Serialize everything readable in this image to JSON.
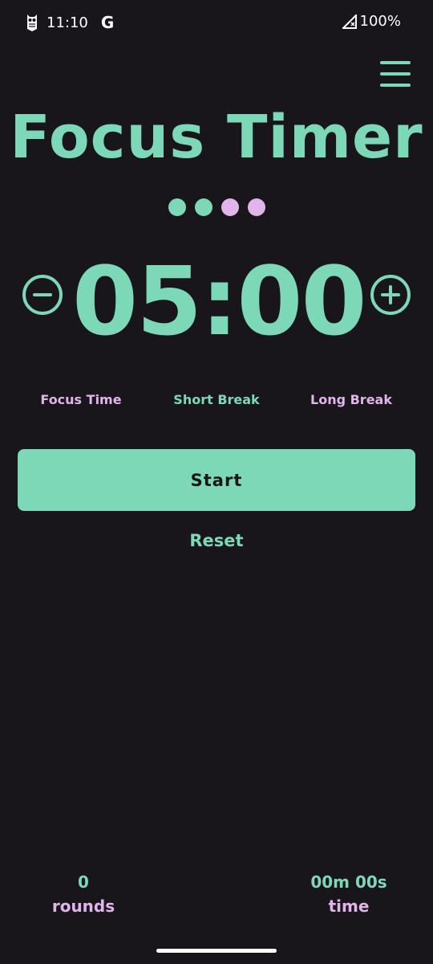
{
  "status_bar": {
    "time": "11:10",
    "google_letter": "G",
    "battery": "100%"
  },
  "app": {
    "title": "Focus Timer",
    "timer": "05:00",
    "round_dots": [
      {
        "state": "done",
        "color": "#7dd8b8"
      },
      {
        "state": "done",
        "color": "#7dd8b8"
      },
      {
        "state": "pending",
        "color": "#e2b4ec"
      },
      {
        "state": "pending",
        "color": "#e2b4ec"
      }
    ],
    "modes": [
      {
        "label": "Focus Time",
        "color": "#e2b4ec",
        "selected": false
      },
      {
        "label": "Short Break",
        "color": "#7dd8b8",
        "selected": true
      },
      {
        "label": "Long Break",
        "color": "#e2b4ec",
        "selected": false
      }
    ],
    "start_label": "Start",
    "reset_label": "Reset",
    "stats": {
      "rounds_value": "0",
      "rounds_label": "rounds",
      "time_value": "00m 00s",
      "time_label": "time"
    }
  },
  "colors": {
    "background": "#18161b",
    "accent": "#7dd8b8",
    "secondary": "#e2b4ec"
  },
  "icons": {
    "menu": "hamburger-menu-icon",
    "decrement": "minus-circle-icon",
    "increment": "plus-circle-icon"
  }
}
